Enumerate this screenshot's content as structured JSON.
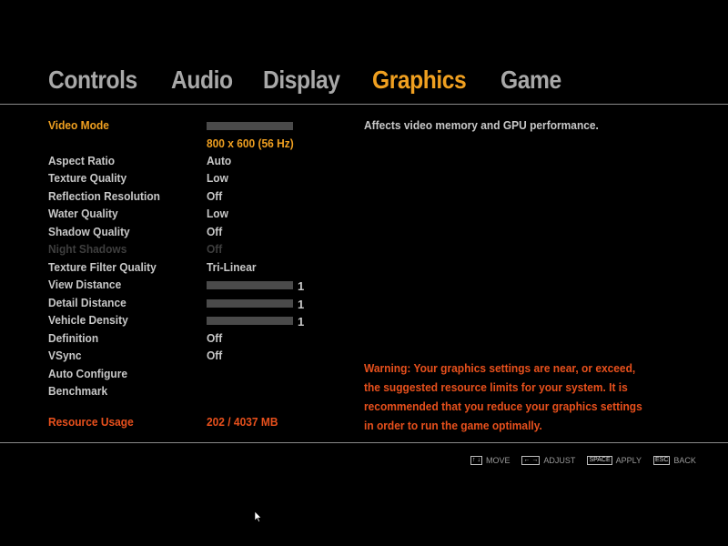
{
  "tabs": [
    {
      "label": "Controls",
      "active": false
    },
    {
      "label": "Audio",
      "active": false
    },
    {
      "label": "Display",
      "active": false
    },
    {
      "label": "Graphics",
      "active": true
    },
    {
      "label": "Game",
      "active": false
    }
  ],
  "settings": {
    "video_mode": {
      "label": "Video Mode",
      "value": "800 x 600 (56 Hz)"
    },
    "aspect_ratio": {
      "label": "Aspect Ratio",
      "value": "Auto"
    },
    "texture_quality": {
      "label": "Texture Quality",
      "value": "Low"
    },
    "reflection_resolution": {
      "label": "Reflection Resolution",
      "value": "Off"
    },
    "water_quality": {
      "label": "Water Quality",
      "value": "Low"
    },
    "shadow_quality": {
      "label": "Shadow Quality",
      "value": "Off"
    },
    "night_shadows": {
      "label": "Night Shadows",
      "value": "Off"
    },
    "texture_filter_quality": {
      "label": "Texture Filter Quality",
      "value": "Tri-Linear"
    },
    "view_distance": {
      "label": "View Distance",
      "value": "1"
    },
    "detail_distance": {
      "label": "Detail Distance",
      "value": "1"
    },
    "vehicle_density": {
      "label": "Vehicle Density",
      "value": "1"
    },
    "definition": {
      "label": "Definition",
      "value": "Off"
    },
    "vsync": {
      "label": "VSync",
      "value": "Off"
    },
    "auto_configure": {
      "label": "Auto Configure"
    },
    "benchmark": {
      "label": "Benchmark"
    },
    "resource_usage": {
      "label": "Resource Usage",
      "value": "202 / 4037 MB"
    }
  },
  "info_text": "Affects video memory and GPU performance.",
  "warning_text": "Warning: Your graphics settings are near, or exceed, the suggested resource limits for your system. It is recommended that you reduce your graphics settings in order to run the game optimally.",
  "hints": {
    "move": {
      "key": "↑ ↓",
      "label": "MOVE"
    },
    "adjust": {
      "key": "← →",
      "label": "ADJUST"
    },
    "apply": {
      "key": "SPACE",
      "label": "APPLY"
    },
    "back": {
      "key": "ESC",
      "label": "BACK"
    }
  },
  "colors": {
    "accent": "#f0a020",
    "warning": "#e8501c",
    "text": "#c8c8c8",
    "disabled": "#3e3e3e",
    "background": "#000000"
  }
}
